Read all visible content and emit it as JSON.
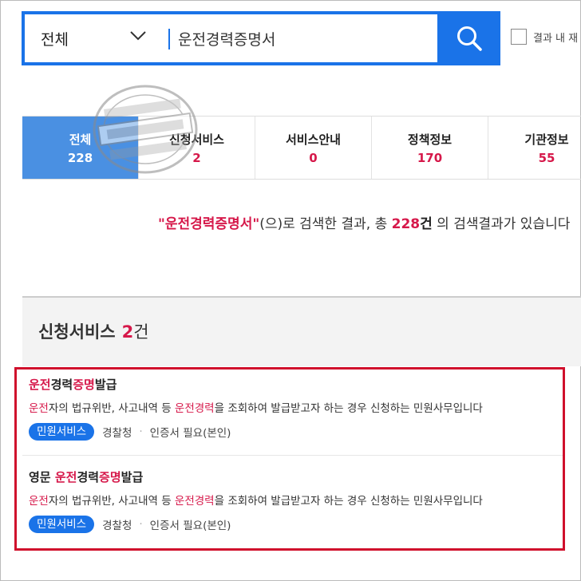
{
  "search": {
    "scope": "전체",
    "query": "운전경력증명서",
    "result_within_label": "결과 내 재"
  },
  "tabs": [
    {
      "label": "전체",
      "count": "228",
      "active": true
    },
    {
      "label": "신청서비스",
      "count": "2",
      "active": false
    },
    {
      "label": "서비스안내",
      "count": "0",
      "active": false
    },
    {
      "label": "정책정보",
      "count": "170",
      "active": false
    },
    {
      "label": "기관정보",
      "count": "55",
      "active": false
    }
  ],
  "summary": {
    "query_quoted": "\"운전경력증명서\"",
    "text1": "(으)로 검색한 결과, 총 ",
    "total": "228",
    "unit": "건",
    "text2": " 의 검색결과가 있습니다"
  },
  "section": {
    "title": "신청서비스",
    "count": "2",
    "unit": "건"
  },
  "results": [
    {
      "title_parts": [
        {
          "text": "운전",
          "hl": true
        },
        {
          "text": "경력",
          "hl": false
        },
        {
          "text": "증명",
          "hl": true
        },
        {
          "text": "발급",
          "hl": false
        }
      ],
      "desc_parts": [
        {
          "text": "운전",
          "hl": true
        },
        {
          "text": "자의 법규위반, 사고내역 등 ",
          "hl": false
        },
        {
          "text": "운전경력",
          "hl": true
        },
        {
          "text": "을 조회하여 발급받고자 하는 경우 신청하는 민원사무입니다",
          "hl": false
        }
      ],
      "badge": "민원서비스",
      "agency": "경찰청",
      "auth": "인증서 필요(본인)"
    },
    {
      "title_parts": [
        {
          "text": "영문 ",
          "hl": false
        },
        {
          "text": "운전",
          "hl": true
        },
        {
          "text": "경력",
          "hl": false
        },
        {
          "text": "증명",
          "hl": true
        },
        {
          "text": "발급",
          "hl": false
        }
      ],
      "desc_parts": [
        {
          "text": "운전",
          "hl": true
        },
        {
          "text": "자의 법규위반, 사고내역 등 ",
          "hl": false
        },
        {
          "text": "운전경력",
          "hl": true
        },
        {
          "text": "을 조회하여 발급받고자 하는 경우 신청하는 민원사무입니다",
          "hl": false
        }
      ],
      "badge": "민원서비스",
      "agency": "경찰청",
      "auth": "인증서 필요(본인)"
    }
  ],
  "colors": {
    "accent": "#1a73e8",
    "active_tab": "#4a90e2",
    "highlight": "#d6184a",
    "annotation_box": "#d0102c"
  },
  "icons": [
    "chevron-down-icon",
    "search-icon",
    "watermark-stamp"
  ]
}
